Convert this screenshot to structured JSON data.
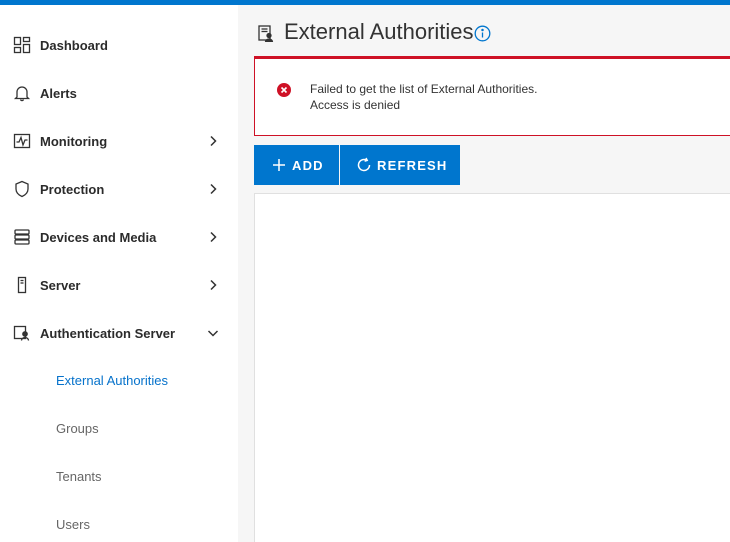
{
  "colors": {
    "accent": "#0076ce",
    "active_link": "#0672cb",
    "error": "#ce1126",
    "main_bg": "#f6f6f6"
  },
  "sidebar": {
    "items": [
      {
        "label": "Dashboard",
        "icon": "dashboard-icon",
        "has_chevron": false
      },
      {
        "label": "Alerts",
        "icon": "bell-icon",
        "has_chevron": false
      },
      {
        "label": "Monitoring",
        "icon": "monitoring-icon",
        "has_chevron": true,
        "chevron": "right"
      },
      {
        "label": "Protection",
        "icon": "shield-icon",
        "has_chevron": true,
        "chevron": "right"
      },
      {
        "label": "Devices and Media",
        "icon": "storage-icon",
        "has_chevron": true,
        "chevron": "right"
      },
      {
        "label": "Server",
        "icon": "server-icon",
        "has_chevron": true,
        "chevron": "right"
      },
      {
        "label": "Authentication Server",
        "icon": "auth-server-icon",
        "has_chevron": true,
        "chevron": "down",
        "expanded": true
      }
    ],
    "sub_items": [
      {
        "label": "External Authorities",
        "active": true
      },
      {
        "label": "Groups",
        "active": false
      },
      {
        "label": "Tenants",
        "active": false
      },
      {
        "label": "Users",
        "active": false
      }
    ]
  },
  "main": {
    "title": "External Authorities",
    "title_icon": "document-user-icon",
    "info_icon": "info-icon",
    "alert": {
      "type": "error",
      "icon": "error-circle-icon",
      "message": "Failed to get the list of External Authorities.",
      "detail": "Access is denied"
    },
    "toolbar": {
      "add_label": "ADD",
      "add_icon": "plus-icon",
      "refresh_label": "REFRESH",
      "refresh_icon": "refresh-icon"
    }
  }
}
